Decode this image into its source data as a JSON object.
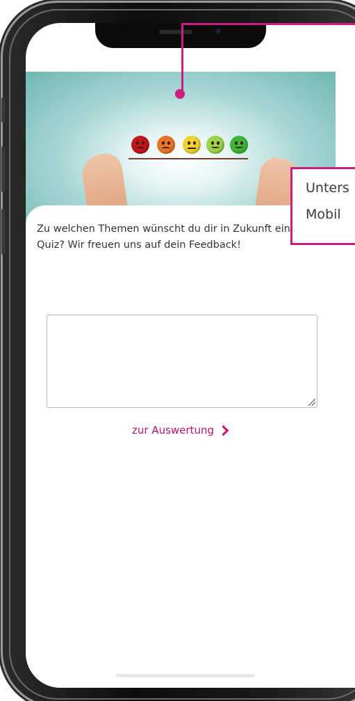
{
  "question": {
    "line1": "Zu welchen Themen wünscht du dir in Zukunft ein",
    "line2": "Quiz? Wir freuen uns auf dein Feedback!"
  },
  "feedback": {
    "value": "",
    "placeholder": ""
  },
  "evaluation_link": {
    "label": "zur Auswertung",
    "icon": "chevron-right-icon"
  },
  "hero": {
    "image": "smiley-rating-scale-image",
    "faces": [
      {
        "mood": "very-sad",
        "color": "#c2151c"
      },
      {
        "mood": "sad",
        "color": "#e8742a"
      },
      {
        "mood": "neutral",
        "color": "#f1d430"
      },
      {
        "mood": "happy",
        "color": "#9bd34a"
      },
      {
        "mood": "very-happy",
        "color": "#3fb63a"
      }
    ]
  },
  "callout": {
    "line1": "Unters",
    "line2": "Mobil"
  },
  "colors": {
    "accent": "#cc1f7d",
    "link": "#b0166e",
    "text": "#333333"
  }
}
